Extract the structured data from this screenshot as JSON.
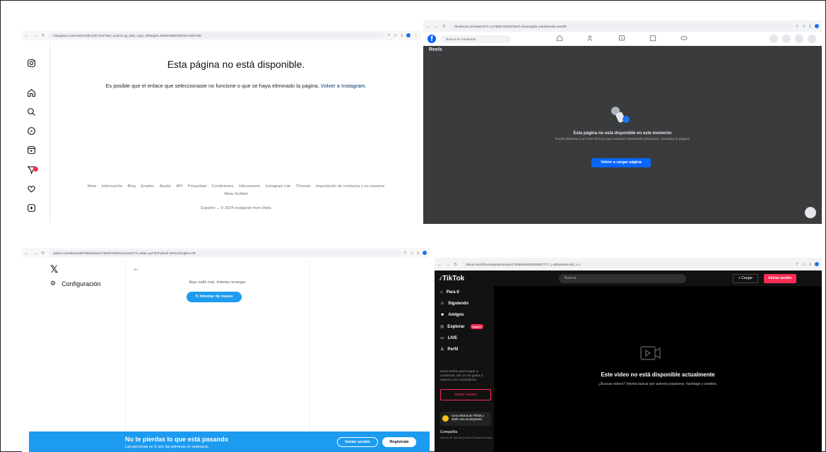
{
  "instagram": {
    "url": "instagram.com/reel/C4Nkr1OP-Xw/?utm_source=ig_web_copy_link&igsh=MzRlODBiNWFlZA%3D%3D",
    "title": "Esta página no está disponible.",
    "message": "Es posible que el enlace que seleccionaste no funcione o que se haya eliminado la página.",
    "link": "Volver a Instagram.",
    "footer_links": [
      "Meta",
      "Información",
      "Blog",
      "Empleo",
      "Ayuda",
      "API",
      "Privacidad",
      "Condiciones",
      "Ubicaciones",
      "Instagram Lite",
      "Threads",
      "Importación de contactos y no usuarios"
    ],
    "footer_extra": "Meta Verified",
    "language": "Español",
    "copyright": "© 2024 Instagram from Meta"
  },
  "facebook": {
    "url": "facebook.com/watch/?v=1478657469307&ref=sharing&fs=e&mibextid=wwXIfr",
    "search_placeholder": "Buscar en Facebook",
    "section": "Reels",
    "heading": "Esta página no está disponible en este momento",
    "body": "Puede deberse a un error técnico que estamos intentando solucionar. Actualiza la página.",
    "button": "Volver a cargar página"
  },
  "twitter": {
    "url": "twitter.com/MarinadePilar/status/1764007362341310447?s=08&t=pyF3GFyNeel-OFICXUcgDw=09",
    "logo": "𝕏",
    "config": "Configuración",
    "back": "←",
    "error": "Algo salió mal. Intenta recargar.",
    "retry": "Intentar de nuevo",
    "banner_title": "No te pierdas lo que está pasando",
    "banner_sub": "Las personas en X son las primeras en enterarse.",
    "login": "Iniciar sesión",
    "register": "Regístrate"
  },
  "tiktok": {
    "url": "tiktok.com/@nomadpilarto/video/7345849650040062777?_t=8k5HeIb4mdk_r=1",
    "logo": "TikTok",
    "search": "Buscar",
    "upload": "+ Cargar",
    "login": "Iniciar sesión",
    "nav": [
      "Para ti",
      "Siguiendo",
      "Amigos",
      "Explorar",
      "LIVE",
      "Perfil"
    ],
    "new_badge": "Nuevo",
    "hint": "Inicia sesión para seguir a creadores, dar un me gusta a videos y ver comentarios.",
    "side_login": "Iniciar sesión",
    "effect_text": "Crea efectos de TikTok y obtén una recompensa",
    "company": "Compañía",
    "company_links": "Acerca de  Sala de prensa  Contacto  Empleo",
    "main_title": "Este video no está disponible actualmente",
    "main_sub": "¿Buscas videos? Intenta buscar por autores populares, hashtags y sonidos."
  }
}
